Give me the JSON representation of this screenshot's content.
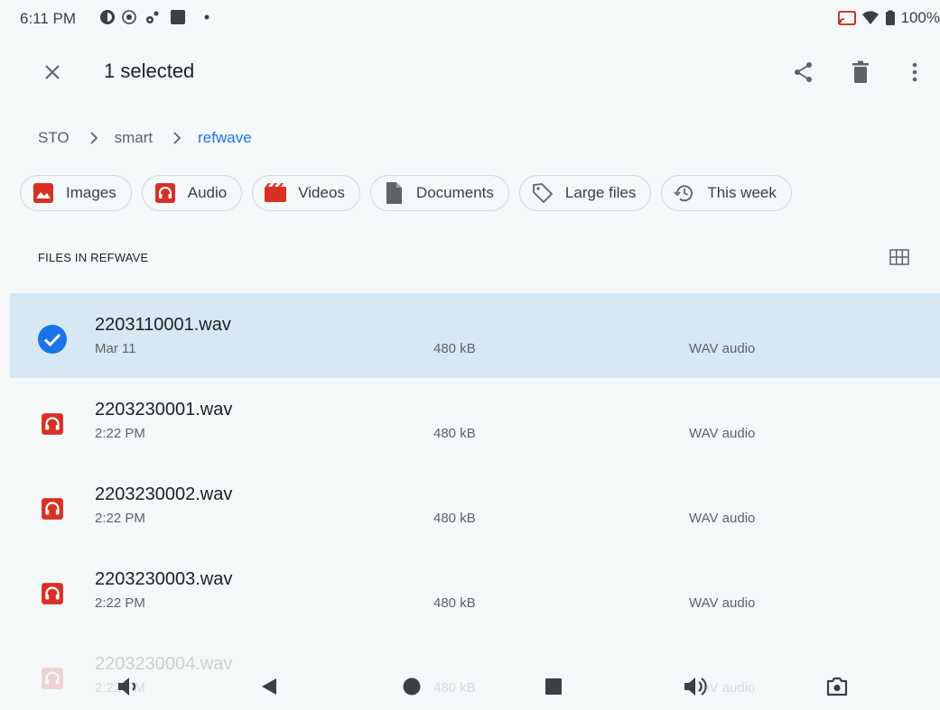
{
  "status_bar": {
    "time": "6:11 PM",
    "left_icons": [
      "app-icon",
      "radio-icon",
      "settings-cog-icon",
      "square-app-icon",
      "dot-icon"
    ],
    "right_icons": [
      "cast-icon",
      "wifi-icon",
      "battery-icon"
    ],
    "battery": "100%"
  },
  "selection_bar": {
    "title": "1 selected",
    "actions": [
      "share-icon",
      "delete-icon",
      "more-vert-icon"
    ]
  },
  "breadcrumb": {
    "items": [
      "STO",
      "smart",
      "refwave"
    ]
  },
  "chips": [
    {
      "label": "Images",
      "icon": "image-icon",
      "color": "#d93025"
    },
    {
      "label": "Audio",
      "icon": "audio-icon",
      "color": "#d93025"
    },
    {
      "label": "Videos",
      "icon": "video-icon",
      "color": "#d93025"
    },
    {
      "label": "Documents",
      "icon": "document-icon",
      "color": "#5f6368"
    },
    {
      "label": "Large files",
      "icon": "tag-icon",
      "color": "#5f6368"
    },
    {
      "label": "This week",
      "icon": "history-icon",
      "color": "#5f6368"
    }
  ],
  "section": {
    "title": "FILES IN REFWAVE"
  },
  "files": [
    {
      "name": "2203110001.wav",
      "date": "Mar 11",
      "size": "480 kB",
      "type": "WAV audio",
      "selected": true
    },
    {
      "name": "2203230001.wav",
      "date": "2:22 PM",
      "size": "480 kB",
      "type": "WAV audio",
      "selected": false
    },
    {
      "name": "2203230002.wav",
      "date": "2:22 PM",
      "size": "480 kB",
      "type": "WAV audio",
      "selected": false
    },
    {
      "name": "2203230003.wav",
      "date": "2:22 PM",
      "size": "480 kB",
      "type": "WAV audio",
      "selected": false
    },
    {
      "name": "2203230004.wav",
      "date": "2:22 PM",
      "size": "480 kB",
      "type": "WAV audio",
      "selected": false
    }
  ],
  "nav_bar": {
    "buttons": [
      "volume-down-icon",
      "back-icon",
      "home-icon",
      "recents-icon",
      "volume-up-icon",
      "screenshot-icon"
    ]
  },
  "colors": {
    "background": "#f4f8f9",
    "selected_row": "#d6e8f3",
    "accent_blue": "#1a73e8",
    "audio_red": "#d93025"
  }
}
